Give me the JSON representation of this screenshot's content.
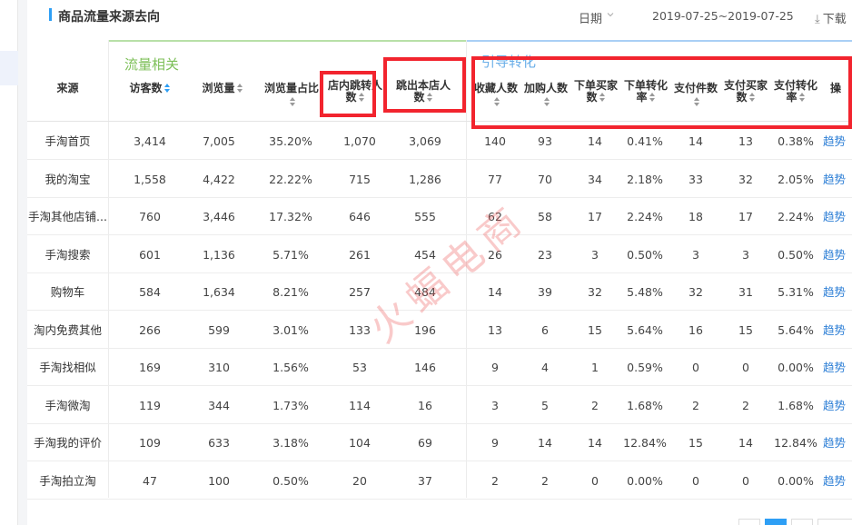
{
  "panel": {
    "title": "商品流量来源去向",
    "date_label": "日期",
    "date_range": "2019-07-25~2019-07-25",
    "download_label": "下载"
  },
  "groups": {
    "traffic": "流量相关",
    "conversion": "引导转化"
  },
  "columns": {
    "source": "来源",
    "visitors": "访客数",
    "pageviews": "浏览量",
    "pv_share": "浏览量占比",
    "in_store_jump_1": "店内跳转人",
    "in_store_jump_2": "数",
    "bounce_1": "跳出本店人",
    "bounce_2": "数",
    "favorites": "收藏人数",
    "add_cart": "加购人数",
    "buyers_1": "下单买家",
    "buyers_2": "数",
    "order_conv_1": "下单转化",
    "order_conv_2": "率",
    "paid_items": "支付件数",
    "paid_buyers_1": "支付买家",
    "paid_buyers_2": "数",
    "pay_conv_1": "支付转化",
    "pay_conv_2": "率",
    "ops": "操"
  },
  "rows": [
    {
      "source": "手淘首页",
      "visitors": "3,414",
      "pageviews": "7,005",
      "pv_share": "35.20%",
      "jump": "1,070",
      "bounce": "3,069",
      "fav": "140",
      "cart": "93",
      "buyers": "14",
      "order_conv": "0.41%",
      "paid_items": "14",
      "paid_buyers": "13",
      "pay_conv": "0.38%",
      "trend": "趋势"
    },
    {
      "source": "我的淘宝",
      "visitors": "1,558",
      "pageviews": "4,422",
      "pv_share": "22.22%",
      "jump": "715",
      "bounce": "1,286",
      "fav": "77",
      "cart": "70",
      "buyers": "34",
      "order_conv": "2.18%",
      "paid_items": "33",
      "paid_buyers": "32",
      "pay_conv": "2.05%",
      "trend": "趋势"
    },
    {
      "source": "手淘其他店铺...",
      "visitors": "760",
      "pageviews": "3,446",
      "pv_share": "17.32%",
      "jump": "646",
      "bounce": "555",
      "fav": "62",
      "cart": "58",
      "buyers": "17",
      "order_conv": "2.24%",
      "paid_items": "18",
      "paid_buyers": "17",
      "pay_conv": "2.24%",
      "trend": "趋势"
    },
    {
      "source": "手淘搜索",
      "visitors": "601",
      "pageviews": "1,136",
      "pv_share": "5.71%",
      "jump": "261",
      "bounce": "454",
      "fav": "26",
      "cart": "23",
      "buyers": "3",
      "order_conv": "0.50%",
      "paid_items": "3",
      "paid_buyers": "3",
      "pay_conv": "0.50%",
      "trend": "趋势"
    },
    {
      "source": "购物车",
      "visitors": "584",
      "pageviews": "1,634",
      "pv_share": "8.21%",
      "jump": "257",
      "bounce": "484",
      "fav": "14",
      "cart": "39",
      "buyers": "32",
      "order_conv": "5.48%",
      "paid_items": "32",
      "paid_buyers": "31",
      "pay_conv": "5.31%",
      "trend": "趋势"
    },
    {
      "source": "淘内免费其他",
      "visitors": "266",
      "pageviews": "599",
      "pv_share": "3.01%",
      "jump": "133",
      "bounce": "196",
      "fav": "13",
      "cart": "6",
      "buyers": "15",
      "order_conv": "5.64%",
      "paid_items": "16",
      "paid_buyers": "15",
      "pay_conv": "5.64%",
      "trend": "趋势"
    },
    {
      "source": "手淘找相似",
      "visitors": "169",
      "pageviews": "310",
      "pv_share": "1.56%",
      "jump": "53",
      "bounce": "146",
      "fav": "9",
      "cart": "4",
      "buyers": "1",
      "order_conv": "0.59%",
      "paid_items": "0",
      "paid_buyers": "0",
      "pay_conv": "0.00%",
      "trend": "趋势"
    },
    {
      "source": "手淘微淘",
      "visitors": "119",
      "pageviews": "344",
      "pv_share": "1.73%",
      "jump": "114",
      "bounce": "16",
      "fav": "3",
      "cart": "5",
      "buyers": "2",
      "order_conv": "1.68%",
      "paid_items": "2",
      "paid_buyers": "2",
      "pay_conv": "1.68%",
      "trend": "趋势"
    },
    {
      "source": "手淘我的评价",
      "visitors": "109",
      "pageviews": "633",
      "pv_share": "3.18%",
      "jump": "104",
      "bounce": "69",
      "fav": "9",
      "cart": "14",
      "buyers": "14",
      "order_conv": "12.84%",
      "paid_items": "15",
      "paid_buyers": "14",
      "pay_conv": "12.84%",
      "trend": "趋势"
    },
    {
      "source": "手淘拍立淘",
      "visitors": "47",
      "pageviews": "100",
      "pv_share": "0.50%",
      "jump": "20",
      "bounce": "37",
      "fav": "2",
      "cart": "2",
      "buyers": "0",
      "order_conv": "0.00%",
      "paid_items": "0",
      "paid_buyers": "0",
      "pay_conv": "0.00%",
      "trend": "趋势"
    }
  ],
  "watermark": "火蝠电商",
  "colors": {
    "accent": "#2e9ff5",
    "traffic_group": "#7cbf57",
    "conversion_group": "#6aaee8",
    "highlight_box": "#f2242e",
    "link": "#2e7fd6"
  }
}
